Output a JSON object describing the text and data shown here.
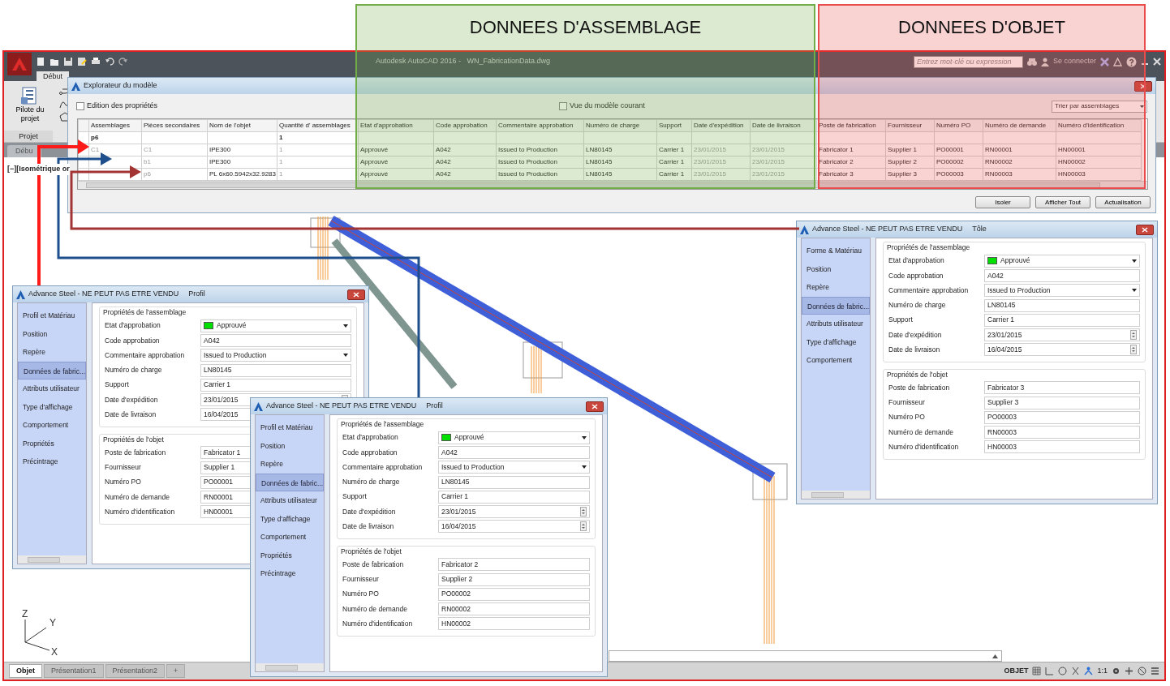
{
  "annotations": [
    {
      "label": "DONNEES D'ASSEMBLAGE",
      "color": "#70ad47"
    },
    {
      "label": "DONNEES D'OBJET",
      "color": "#e84c4c"
    }
  ],
  "app": {
    "title": "Autodesk AutoCAD 2016 -   WN_FabricationData.dwg",
    "search": {
      "placeholder": "Entrez mot-clé ou expression"
    },
    "sign_in": "Se connecter",
    "ribbon_tab": "Début",
    "ribbon_button": "Pilote du projet",
    "panel_label": "Projet",
    "file_tab": "Débu",
    "viewport_label": "[−][Isométrique or",
    "ucs_axes": [
      "Z",
      "Y",
      "X"
    ],
    "layout_tabs": [
      {
        "label": "Objet",
        "selected": true
      },
      {
        "label": "Présentation1",
        "selected": false
      },
      {
        "label": "Présentation2",
        "selected": false
      },
      {
        "label": "+",
        "selected": false
      }
    ],
    "status_bar": {
      "mode": "OBJET",
      "scale": "1:1"
    }
  },
  "explorer": {
    "title": "Explorateur du modèle",
    "edit_properties": {
      "label": "Edition des propriétés",
      "checked": false
    },
    "current_view": {
      "label": "Vue du modèle courant",
      "checked": false
    },
    "sort": "Trier par assemblages",
    "columns": [
      {
        "label": "Assemblages",
        "dim": true
      },
      {
        "label": "Pièces secondaires",
        "dim": true
      },
      {
        "label": "Nom de l'objet",
        "dim": false
      },
      {
        "label": "Quantité d' assemblages",
        "dim": true
      },
      {
        "label": "Etat d'approbation",
        "dim": false
      },
      {
        "label": "Code approbation",
        "dim": false
      },
      {
        "label": "Commentaire approbation",
        "dim": false
      },
      {
        "label": "Numéro de charge",
        "dim": false
      },
      {
        "label": "Support",
        "dim": false
      },
      {
        "label": "Date d'expédition",
        "dim": true
      },
      {
        "label": "Date de livraison",
        "dim": true
      },
      {
        "label": "Poste de fabrication",
        "dim": false
      },
      {
        "label": "Fournisseur",
        "dim": false
      },
      {
        "label": "Numéro PO",
        "dim": false
      },
      {
        "label": "Numéro de demande",
        "dim": false
      },
      {
        "label": "Numéro d'identification",
        "dim": false
      }
    ],
    "rows": [
      {
        "kind": "group",
        "cells": [
          "p6",
          "",
          "",
          "1",
          "",
          "",
          "",
          "",
          "",
          "",
          "",
          "",
          "",
          "",
          "",
          ""
        ]
      },
      {
        "kind": "item",
        "cells": [
          "C1",
          "C1",
          "IPE300",
          "1",
          "Approuvé",
          "A042",
          "Issued to Production",
          "LN80145",
          "Carrier 1",
          "23/01/2015",
          "23/01/2015",
          "Fabricator 1",
          "Supplier 1",
          "PO00001",
          "RN00001",
          "HN00001"
        ]
      },
      {
        "kind": "item",
        "cells": [
          "",
          "b1",
          "IPE300",
          "1",
          "Approuvé",
          "A042",
          "Issued to Production",
          "LN80145",
          "Carrier 1",
          "23/01/2015",
          "23/01/2015",
          "Fabricator 2",
          "Supplier 2",
          "PO00002",
          "RN00002",
          "HN00002"
        ]
      },
      {
        "kind": "item",
        "cells": [
          "",
          "p6",
          "PL 6x60.5942x32.9283",
          "1",
          "Approuvé",
          "A042",
          "Issued to Production",
          "LN80145",
          "Carrier 1",
          "23/01/2015",
          "23/01/2015",
          "Fabricator 3",
          "Supplier 3",
          "PO00003",
          "RN00003",
          "HN00003"
        ]
      }
    ],
    "buttons": [
      "Isoler",
      "Afficher Tout",
      "Actualisation"
    ]
  },
  "dialogs": [
    {
      "title": "Advance Steel - NE PEUT PAS ETRE VENDU",
      "subtitle": "Profil",
      "nav": [
        {
          "label": "Profil et Matériau",
          "selected": false
        },
        {
          "label": "Position",
          "selected": false
        },
        {
          "label": "Repère",
          "selected": false
        },
        {
          "label": "Données de fabric...",
          "selected": true
        },
        {
          "label": "Attributs utilisateur",
          "selected": false
        },
        {
          "label": "Type d'affichage",
          "selected": false
        },
        {
          "label": "Comportement",
          "selected": false
        },
        {
          "label": "Propriétés",
          "selected": false
        },
        {
          "label": "Précintrage",
          "selected": false
        }
      ],
      "groups": [
        {
          "title": "Propriétés de l'assemblage",
          "fields": [
            {
              "label": "Etat d'approbation",
              "kind": "status",
              "value": "Approuvé",
              "color": "#00e000"
            },
            {
              "label": "Code approbation",
              "kind": "text",
              "value": "A042"
            },
            {
              "label": "Commentaire approbation",
              "kind": "select",
              "value": "Issued to Production"
            },
            {
              "label": "Numéro de charge",
              "kind": "text",
              "value": "LN80145"
            },
            {
              "label": "Support",
              "kind": "text",
              "value": "Carrier 1"
            },
            {
              "label": "Date d'expédition",
              "kind": "date",
              "value": "23/01/2015"
            },
            {
              "label": "Date de livraison",
              "kind": "date",
              "value": "16/04/2015"
            }
          ]
        },
        {
          "title": "Propriétés de l'objet",
          "fields": [
            {
              "label": "Poste de fabrication",
              "kind": "text",
              "value": "Fabricator 1"
            },
            {
              "label": "Fournisseur",
              "kind": "text",
              "value": "Supplier 1"
            },
            {
              "label": "Numéro PO",
              "kind": "text",
              "value": "PO00001"
            },
            {
              "label": "Numéro de demande",
              "kind": "text",
              "value": "RN00001"
            },
            {
              "label": "Numéro d'identification",
              "kind": "text",
              "value": "HN00001"
            }
          ]
        }
      ]
    },
    {
      "title": "Advance Steel - NE PEUT PAS ETRE VENDU",
      "subtitle": "Profil",
      "nav": [
        {
          "label": "Profil et Matériau",
          "selected": false
        },
        {
          "label": "Position",
          "selected": false
        },
        {
          "label": "Repère",
          "selected": false
        },
        {
          "label": "Données de fabric...",
          "selected": true
        },
        {
          "label": "Attributs utilisateur",
          "selected": false
        },
        {
          "label": "Type d'affichage",
          "selected": false
        },
        {
          "label": "Comportement",
          "selected": false
        },
        {
          "label": "Propriétés",
          "selected": false
        },
        {
          "label": "Précintrage",
          "selected": false
        }
      ],
      "groups": [
        {
          "title": "Propriétés de l'assemblage",
          "fields": [
            {
              "label": "Etat d'approbation",
              "kind": "status",
              "value": "Approuvé",
              "color": "#00e000"
            },
            {
              "label": "Code approbation",
              "kind": "text",
              "value": "A042"
            },
            {
              "label": "Commentaire approbation",
              "kind": "select",
              "value": "Issued to Production"
            },
            {
              "label": "Numéro de charge",
              "kind": "text",
              "value": "LN80145"
            },
            {
              "label": "Support",
              "kind": "text",
              "value": "Carrier 1"
            },
            {
              "label": "Date d'expédition",
              "kind": "date",
              "value": "23/01/2015"
            },
            {
              "label": "Date de livraison",
              "kind": "date",
              "value": "16/04/2015"
            }
          ]
        },
        {
          "title": "Propriétés de l'objet",
          "fields": [
            {
              "label": "Poste de fabrication",
              "kind": "text",
              "value": "Fabricator 2"
            },
            {
              "label": "Fournisseur",
              "kind": "text",
              "value": "Supplier 2"
            },
            {
              "label": "Numéro PO",
              "kind": "text",
              "value": "PO00002"
            },
            {
              "label": "Numéro de demande",
              "kind": "text",
              "value": "RN00002"
            },
            {
              "label": "Numéro d'identification",
              "kind": "text",
              "value": "HN00002"
            }
          ]
        }
      ]
    },
    {
      "title": "Advance Steel - NE PEUT PAS ETRE VENDU",
      "subtitle": "Tôle",
      "nav": [
        {
          "label": "Forme & Matériau",
          "selected": false
        },
        {
          "label": "Position",
          "selected": false
        },
        {
          "label": "Repère",
          "selected": false
        },
        {
          "label": "Données de fabric...",
          "selected": true
        },
        {
          "label": "Attributs utilisateur",
          "selected": false
        },
        {
          "label": "Type d'affichage",
          "selected": false
        },
        {
          "label": "Comportement",
          "selected": false
        }
      ],
      "groups": [
        {
          "title": "Propriétés de l'assemblage",
          "fields": [
            {
              "label": "Etat d'approbation",
              "kind": "status",
              "value": "Approuvé",
              "color": "#00e000"
            },
            {
              "label": "Code approbation",
              "kind": "text",
              "value": "A042"
            },
            {
              "label": "Commentaire approbation",
              "kind": "select",
              "value": "Issued to Production"
            },
            {
              "label": "Numéro de charge",
              "kind": "text",
              "value": "LN80145"
            },
            {
              "label": "Support",
              "kind": "text",
              "value": "Carrier 1"
            },
            {
              "label": "Date d'expédition",
              "kind": "date",
              "value": "23/01/2015"
            },
            {
              "label": "Date de livraison",
              "kind": "date",
              "value": "16/04/2015"
            }
          ]
        },
        {
          "title": "Propriétés de l'objet",
          "fields": [
            {
              "label": "Poste de fabrication",
              "kind": "text",
              "value": "Fabricator 3"
            },
            {
              "label": "Fournisseur",
              "kind": "text",
              "value": "Supplier 3"
            },
            {
              "label": "Numéro PO",
              "kind": "text",
              "value": "PO00003"
            },
            {
              "label": "Numéro de demande",
              "kind": "text",
              "value": "RN00003"
            },
            {
              "label": "Numéro d'identification",
              "kind": "text",
              "value": "HN00003"
            }
          ]
        }
      ]
    }
  ]
}
